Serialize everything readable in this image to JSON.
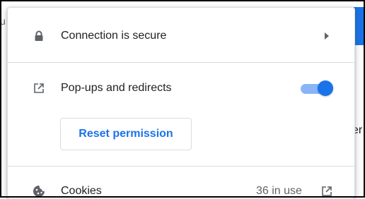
{
  "background": {
    "left_fragment": "u",
    "right_fragment": "er",
    "accent_color": "#1a73e8"
  },
  "popup": {
    "connection": {
      "label": "Connection is secure",
      "icon": "lock-icon",
      "chevron_icon": "chevron-right-icon"
    },
    "popups": {
      "label": "Pop-ups and redirects",
      "icon": "external-link-icon",
      "toggle_on": true,
      "reset_label": "Reset permission"
    },
    "cookies": {
      "label": "Cookies",
      "icon": "cookie-icon",
      "status": "36 in use",
      "external_icon": "external-link-icon"
    }
  }
}
